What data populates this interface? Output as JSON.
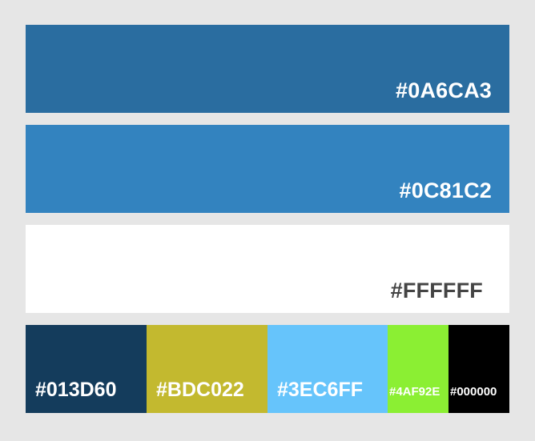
{
  "palette": {
    "bars": [
      {
        "hex": "#0A6CA3",
        "color": "#2a6da0"
      },
      {
        "hex": "#0C81C2",
        "color": "#3383bf"
      },
      {
        "hex": "#FFFFFF",
        "color": "#ffffff"
      }
    ],
    "strip": [
      {
        "hex": "#013D60",
        "color": "#143c5c"
      },
      {
        "hex": "#BDC022",
        "color": "#c3b92f"
      },
      {
        "hex": "#3EC6FF",
        "color": "#66c4fb"
      },
      {
        "hex": "#4AF92E",
        "color": "#8bef33"
      },
      {
        "hex": "#000000",
        "color": "#000000"
      }
    ]
  }
}
